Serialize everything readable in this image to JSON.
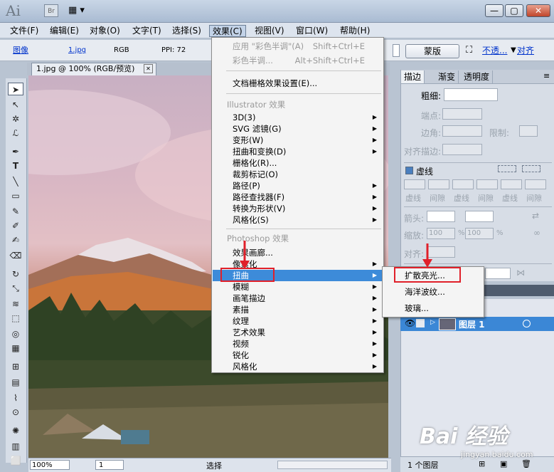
{
  "app": {
    "logo": "Ai",
    "bridge_label": "Br",
    "layout_icon": "▦ ▾",
    "window_buttons": [
      "—",
      "▢",
      "✕"
    ]
  },
  "menubar": [
    {
      "label": "文件(F)"
    },
    {
      "label": "编辑(E)"
    },
    {
      "label": "对象(O)"
    },
    {
      "label": "文字(T)"
    },
    {
      "label": "选择(S)"
    },
    {
      "label": "效果(C)"
    },
    {
      "label": "视图(V)"
    },
    {
      "label": "窗口(W)"
    },
    {
      "label": "帮助(H)"
    }
  ],
  "control_bar": {
    "image_label": "图像",
    "filename": "1.jpg",
    "color_mode": "RGB",
    "ppi": "PPI: 72",
    "button_label": "蒙版",
    "opacity_link": "不透...",
    "align_link": "对齐"
  },
  "document_tab": {
    "title": "1.jpg @ 100% (RGB/预览)",
    "close": "✕"
  },
  "effect_menu": {
    "items": [
      {
        "label": "应用 \"彩色半调\"(A)",
        "shortcut": "Shift+Ctrl+E",
        "disabled": true
      },
      {
        "label": "彩色半调...",
        "shortcut": "Alt+Shift+Ctrl+E",
        "disabled": true
      },
      {
        "label": "文档栅格效果设置(E)..."
      },
      {
        "label": "Illustrator 效果",
        "heading": true
      },
      {
        "label": "3D(3)",
        "arrow": true
      },
      {
        "label": "SVG 滤镜(G)",
        "arrow": true
      },
      {
        "label": "变形(W)",
        "arrow": true
      },
      {
        "label": "扭曲和变换(D)",
        "arrow": true
      },
      {
        "label": "栅格化(R)..."
      },
      {
        "label": "裁剪标记(O)"
      },
      {
        "label": "路径(P)",
        "arrow": true
      },
      {
        "label": "路径查找器(F)",
        "arrow": true
      },
      {
        "label": "转换为形状(V)",
        "arrow": true
      },
      {
        "label": "风格化(S)",
        "arrow": true
      },
      {
        "label": "Photoshop 效果",
        "heading": true
      },
      {
        "label": "效果画廊..."
      },
      {
        "label": "像素化",
        "arrow": true
      },
      {
        "label": "扭曲",
        "arrow": true,
        "highlighted": true
      },
      {
        "label": "模糊",
        "arrow": true
      },
      {
        "label": "画笔描边",
        "arrow": true
      },
      {
        "label": "素描",
        "arrow": true
      },
      {
        "label": "纹理",
        "arrow": true
      },
      {
        "label": "艺术效果",
        "arrow": true
      },
      {
        "label": "视频",
        "arrow": true
      },
      {
        "label": "锐化",
        "arrow": true
      },
      {
        "label": "风格化",
        "arrow": true
      }
    ]
  },
  "distort_submenu": {
    "items": [
      {
        "label": "扩散亮光..."
      },
      {
        "label": "海洋波纹..."
      },
      {
        "label": "玻璃..."
      }
    ]
  },
  "stroke_panel": {
    "tabs": [
      "描边",
      "渐变",
      "透明度"
    ],
    "weight_label": "粗细:",
    "cap_label": "端点:",
    "corner_label": "边角:",
    "limit_label": "限制:",
    "align_label": "对齐描边:",
    "dashed_label": "虚线",
    "dash_labels": [
      "虚线",
      "间隙",
      "虚线",
      "间隙",
      "虚线",
      "间隙"
    ],
    "arrow_label": "箭头:",
    "scale_label": "缩放:",
    "scale_value_1": "100",
    "scale_value_2": "100",
    "percent": "%",
    "align2_label": "对齐:"
  },
  "layers_panel": {
    "layer_name": "图层 1",
    "footer": "1 个图层"
  },
  "statusbar": {
    "zoom": "100%",
    "page": "1",
    "tool": "选择"
  },
  "watermark": {
    "text": "Bai 经验",
    "url": "jingyan.baidu.com"
  }
}
